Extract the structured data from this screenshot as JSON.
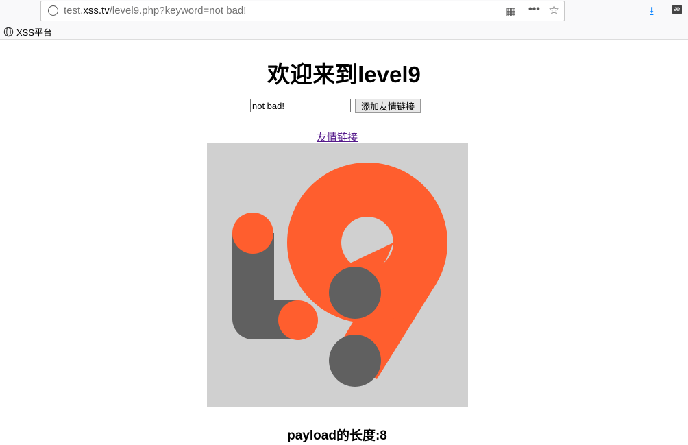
{
  "browser": {
    "url_host": "test.xss.tv",
    "url_prefix": "test.",
    "url_domain": "xss.tv",
    "url_path": "/level9.php?keyword=not bad!",
    "bookmark": "XSS平台"
  },
  "page": {
    "title": "欢迎来到level9",
    "input_value": "not bad!",
    "submit_label": "添加友情链接",
    "link_text": "友情链接",
    "payload_length": "payload的长度:8"
  },
  "colors": {
    "orange": "#ff5e2e",
    "gray": "#606060",
    "bg": "#d0d0d0"
  }
}
